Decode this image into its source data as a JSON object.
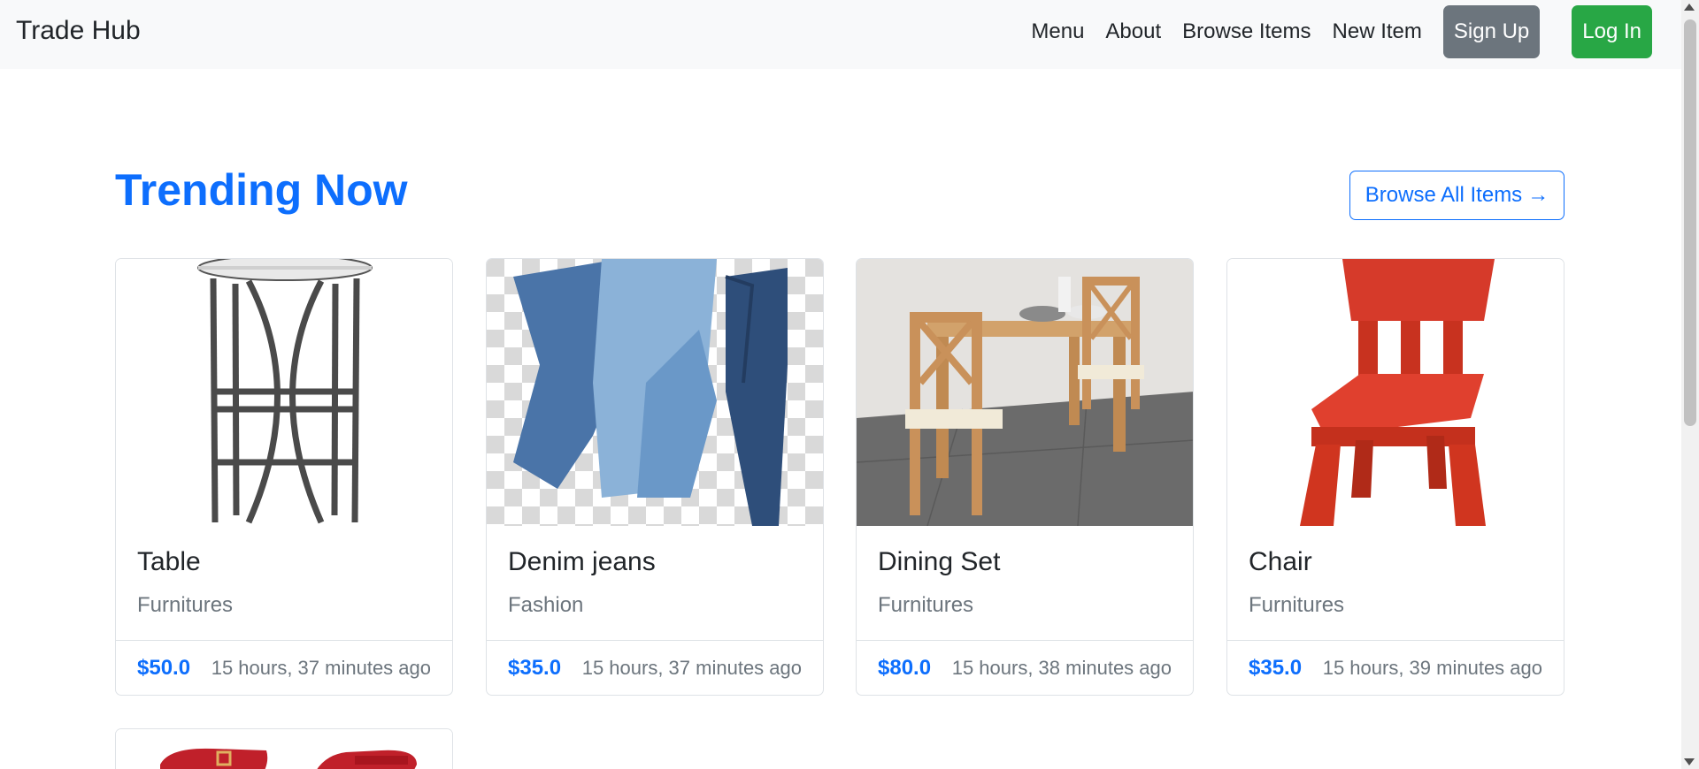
{
  "navbar": {
    "brand": "Trade Hub",
    "links": [
      "Menu",
      "About",
      "Browse Items",
      "New Item"
    ],
    "signup_label": "Sign Up",
    "login_label": "Log In"
  },
  "main": {
    "heading": "Trending Now",
    "browse_all_label": "Browse All Items",
    "browse_all_arrow": "→"
  },
  "items": [
    {
      "title": "Table",
      "category": "Furnitures",
      "price": "$50.0",
      "time": "15 hours, 37 minutes ago"
    },
    {
      "title": "Denim jeans",
      "category": "Fashion",
      "price": "$35.0",
      "time": "15 hours, 37 minutes ago"
    },
    {
      "title": "Dining Set",
      "category": "Furnitures",
      "price": "$80.0",
      "time": "15 hours, 38 minutes ago"
    },
    {
      "title": "Chair",
      "category": "Furnitures",
      "price": "$35.0",
      "time": "15 hours, 39 minutes ago"
    }
  ],
  "colors": {
    "primary": "#0d6efd",
    "secondary": "#6c757d",
    "success": "#28a745",
    "navbar_bg": "#f8f9fa"
  }
}
